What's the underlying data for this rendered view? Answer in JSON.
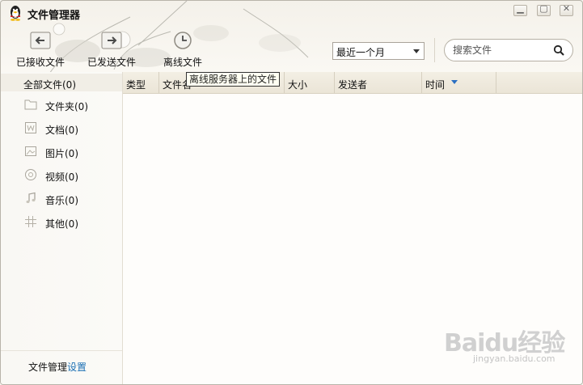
{
  "window": {
    "title": "文件管理器"
  },
  "toolbar": {
    "received_label": "已接收文件",
    "sent_label": "已发送文件",
    "offline_label": "离线文件"
  },
  "filter": {
    "selected": "最近一个月"
  },
  "search": {
    "placeholder": "搜索文件"
  },
  "tooltip": {
    "text": "离线服务器上的文件"
  },
  "nav": {
    "all_label": "全部文件(0)",
    "items": [
      {
        "label": "文件夹(0)",
        "icon": "folder-icon"
      },
      {
        "label": "文档(0)",
        "icon": "document-icon"
      },
      {
        "label": "图片(0)",
        "icon": "image-icon"
      },
      {
        "label": "视频(0)",
        "icon": "video-icon"
      },
      {
        "label": "音乐(0)",
        "icon": "music-icon"
      },
      {
        "label": "其他(0)",
        "icon": "other-icon"
      }
    ],
    "footer_text": "文件管理",
    "footer_link": "设置"
  },
  "columns": {
    "type": "类型",
    "name": "文件名",
    "size": "大小",
    "sender": "发送者",
    "time": "时间"
  },
  "watermark": {
    "brand": "Baidu经验",
    "site": "jingyan.baidu.com"
  },
  "colors": {
    "link": "#1a6fb4",
    "sort_arrow": "#2b6fc2",
    "header_bg": "#ebe5d7"
  }
}
